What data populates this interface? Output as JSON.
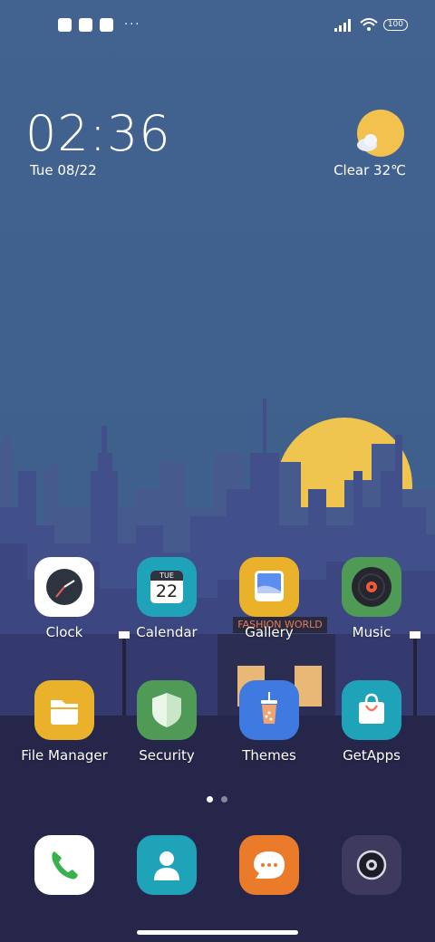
{
  "status_bar": {
    "left_icons": [
      "app-notification-icon",
      "square-notification-icon",
      "upload-icon"
    ],
    "more": "···",
    "battery": "100"
  },
  "clock": {
    "time": "02:36",
    "date": "Tue 08/22"
  },
  "weather": {
    "icon": "sun-cloud-icon",
    "text": "Clear  32℃"
  },
  "wallpaper": {
    "sign_text": "FASHION WORLD"
  },
  "apps": [
    {
      "label": "Clock",
      "icon": "clock-icon"
    },
    {
      "label": "Calendar",
      "icon": "calendar-icon",
      "day_name": "TUE",
      "day_number": "22"
    },
    {
      "label": "Gallery",
      "icon": "gallery-icon"
    },
    {
      "label": "Music",
      "icon": "music-icon"
    },
    {
      "label": "File Manager",
      "icon": "folder-icon"
    },
    {
      "label": "Security",
      "icon": "shield-icon"
    },
    {
      "label": "Themes",
      "icon": "themes-icon"
    },
    {
      "label": "GetApps",
      "icon": "shopping-bag-icon"
    }
  ],
  "dock": [
    {
      "name": "Phone",
      "icon": "phone-icon"
    },
    {
      "name": "Contacts",
      "icon": "contacts-icon"
    },
    {
      "name": "Messaging",
      "icon": "message-icon"
    },
    {
      "name": "Camera",
      "icon": "camera-icon"
    }
  ],
  "page_indicator": {
    "pages": 2,
    "current": 1
  },
  "colors": {
    "sky": "#41628f",
    "sun": "#f2c14e",
    "clock_icon": "#ffffff",
    "calendar_icon": "#1ea3b8",
    "gallery_icon": "#eab12a",
    "music_icon": "#4f9a55",
    "files_icon": "#eab12a",
    "security_icon": "#4f9a55",
    "themes_icon": "#3f7ae0",
    "getapps_icon": "#1ea3b8",
    "messaging_icon": "#ea7b2b",
    "camera_icon": "#3d3a5e"
  }
}
